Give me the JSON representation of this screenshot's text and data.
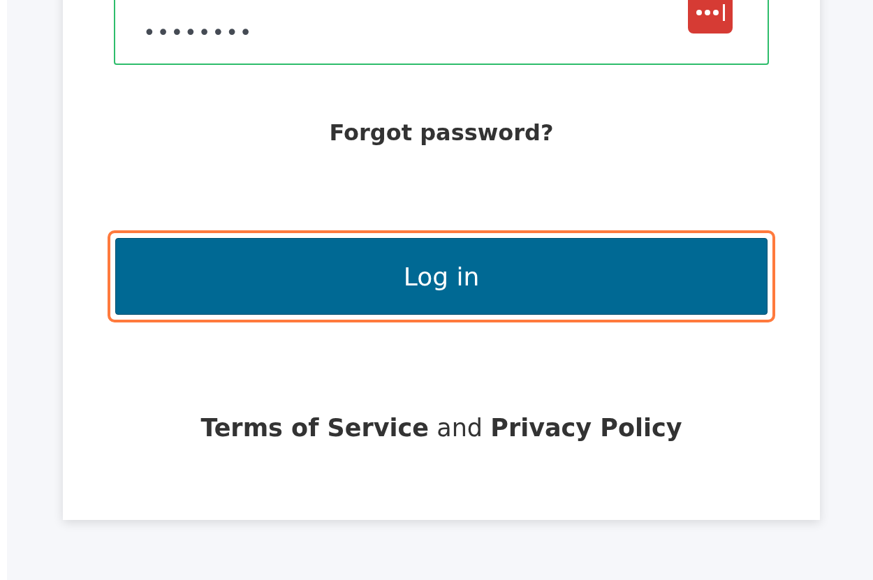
{
  "login_form": {
    "password_field": {
      "value": "••••••••",
      "focused": true
    },
    "forgot_link": "Forgot password?",
    "login_button": {
      "label": "Log in",
      "highlighted": true
    },
    "legal": {
      "terms_link": "Terms of Service",
      "joiner": "and",
      "privacy_link": "Privacy Policy"
    }
  }
}
